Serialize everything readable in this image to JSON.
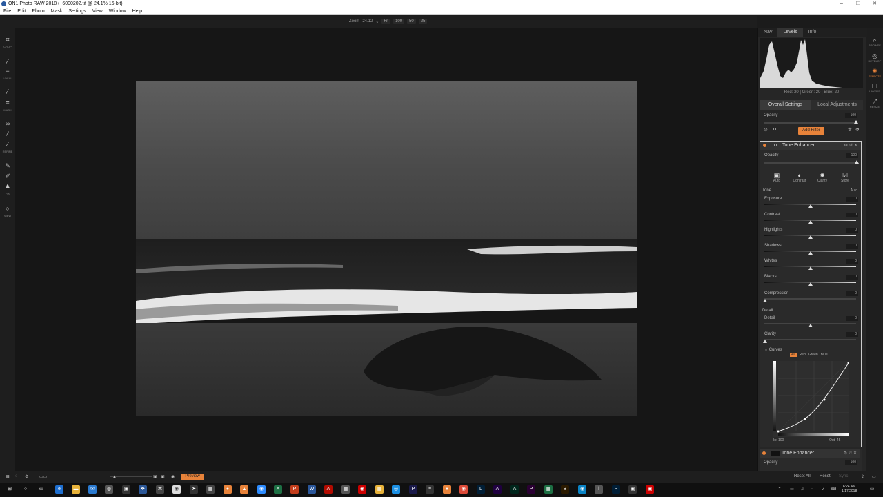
{
  "window": {
    "title": "ON1 Photo RAW 2018 (_6000202.tif @ 24.1% 16-bit)",
    "controls": [
      "–",
      "❐",
      "✕"
    ]
  },
  "menu": [
    "File",
    "Edit",
    "Photo",
    "Mask",
    "Settings",
    "View",
    "Window",
    "Help"
  ],
  "toolbar": {
    "zoom_label": "Zoom",
    "zoom_value": "24.12",
    "zoom_presets": [
      "Fit",
      "100",
      "50",
      "25"
    ]
  },
  "left_tools": {
    "groups": [
      "CROP",
      "LOCAL",
      "MASK",
      "REFINE",
      "FIX",
      "VIEW"
    ]
  },
  "modules": [
    "BROWSE",
    "DEVELOP",
    "EFFECTS",
    "LAYERS",
    "RESIZE"
  ],
  "active_module": "EFFECTS",
  "panel": {
    "nav_tabs": [
      "Nav",
      "Levels",
      "Info"
    ],
    "active_nav_tab": "Levels",
    "histogram_readout": "Red: 20  | Green: 20  | Blue: 20",
    "setting_tabs": [
      "Overall Settings",
      "Local Adjustments"
    ],
    "active_setting_tab": "Overall Settings",
    "overall_opacity_label": "Opacity",
    "overall_opacity_value": "100",
    "add_filter_label": "Add Filter"
  },
  "filter": {
    "name": "Tone Enhancer",
    "opacity_label": "Opacity",
    "opacity_value": "100",
    "presets": [
      "Auto",
      "Contrast",
      "Clarity",
      "Store"
    ],
    "tone_section": "Tone",
    "tone_auto": "Auto",
    "sliders": [
      {
        "label": "Exposure",
        "value": "0"
      },
      {
        "label": "Contrast",
        "value": "0"
      },
      {
        "label": "Highlights",
        "value": "0"
      },
      {
        "label": "Shadows",
        "value": "0"
      },
      {
        "label": "Whites",
        "value": "0"
      },
      {
        "label": "Blacks",
        "value": "0"
      }
    ],
    "compression_label": "Compression",
    "compression_value": "0",
    "detail_section": "Detail",
    "detail_label": "Detail",
    "detail_value": "0",
    "clarity_label": "Clarity",
    "clarity_value": "0",
    "curves_label": "Curves",
    "curve_channels": [
      "All",
      "Red",
      "Green",
      "Blue"
    ],
    "active_channel": "All",
    "curve_in": "In: 100",
    "curve_out": "Out: 45"
  },
  "filter2": {
    "name": "Tone Enhancer",
    "opacity_label": "Opacity",
    "opacity_value": "100"
  },
  "bottom": {
    "preview_label": "Preview",
    "reset_all": "Reset All",
    "reset": "Reset",
    "sync": "Sync"
  },
  "taskbar": {
    "time": "6:24 AM",
    "date": "1/17/2018"
  },
  "colors": {
    "accent": "#e8833a"
  }
}
